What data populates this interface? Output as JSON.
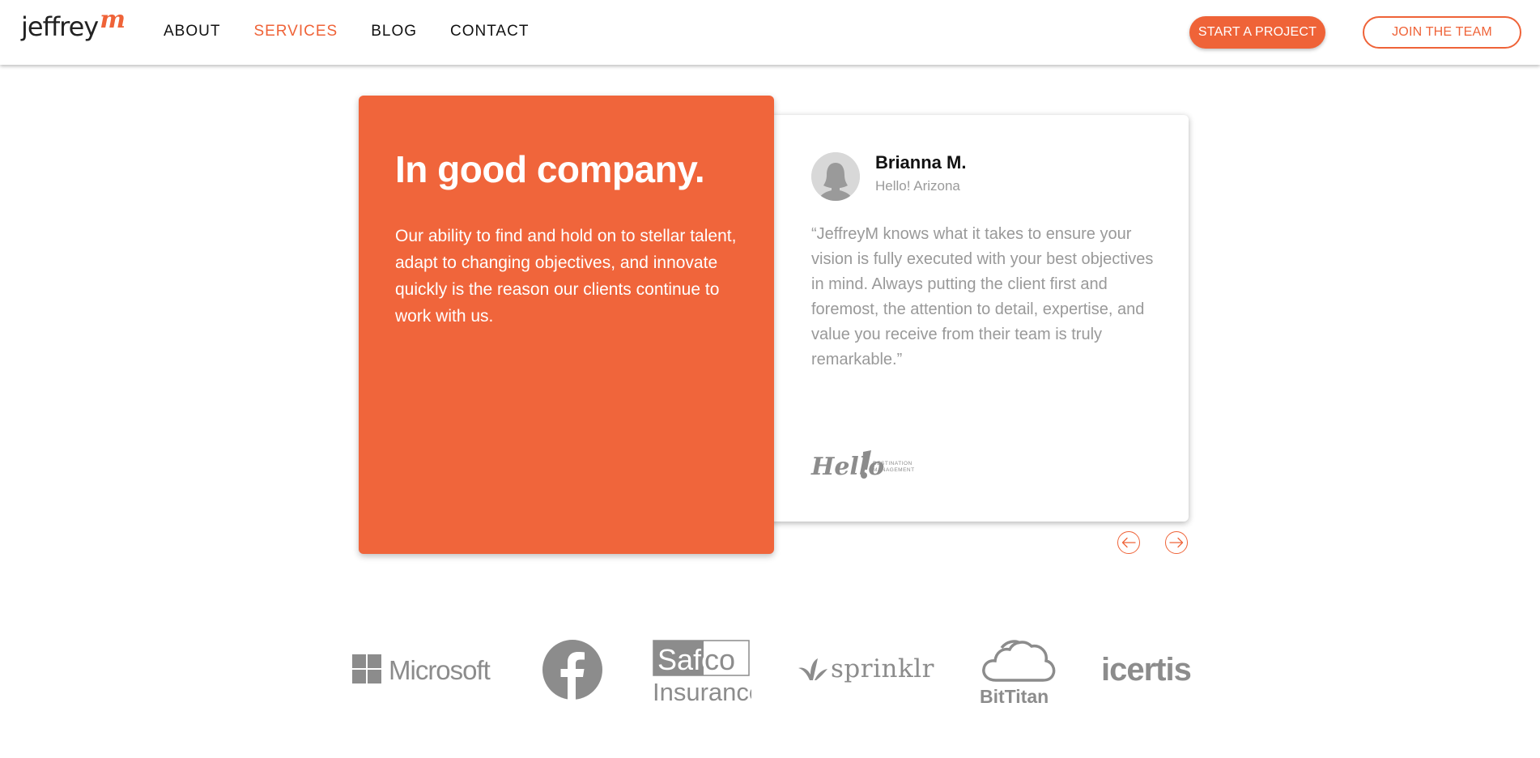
{
  "header": {
    "logo": {
      "word": "jeffrey",
      "mark": "m"
    },
    "nav": [
      {
        "label": "ABOUT",
        "active": false
      },
      {
        "label": "SERVICES",
        "active": true
      },
      {
        "label": "BLOG",
        "active": false
      },
      {
        "label": "CONTACT",
        "active": false
      }
    ],
    "primary_cta": "START A PROJECT",
    "secondary_cta": "JOIN THE TEAM"
  },
  "intro": {
    "title": "In good company.",
    "body": "Our ability to find and hold on to stellar talent, adapt to changing objectives, and innovate quickly is the reason our clients continue to work with us."
  },
  "testimonial": {
    "name": "Brianna M.",
    "organization": "Hello! Arizona",
    "quote": "“JeffreyM knows what it takes to ensure your vision is fully executed with your best objectives in mind. Always putting the client first and foremost, the attention to detail, expertise, and value you receive from their team is truly remarkable.”",
    "client_logo": {
      "word": "Hello",
      "tagline_1": "DESTINATION",
      "tagline_2": "MANAGEMENT"
    }
  },
  "carousel": {
    "prev_icon": "arrow-left-icon",
    "next_icon": "arrow-right-icon"
  },
  "partners": [
    {
      "name": "Microsoft",
      "icon": "microsoft-logo"
    },
    {
      "name": "facebook",
      "icon": "facebook-logo"
    },
    {
      "name": "Safeco Insurance",
      "top_a": "Safe",
      "top_b": "co",
      "bottom": "Insurance",
      "icon": "safeco-logo"
    },
    {
      "name": "sprinklr",
      "icon": "sprinklr-logo"
    },
    {
      "name": "BitTitan",
      "icon": "bittitan-logo"
    },
    {
      "name": "icertis",
      "icon": "icertis-logo"
    }
  ],
  "colors": {
    "brand_orange": "#f0653b",
    "partner_gray": "#8c8c8c",
    "muted_text": "#999999"
  }
}
